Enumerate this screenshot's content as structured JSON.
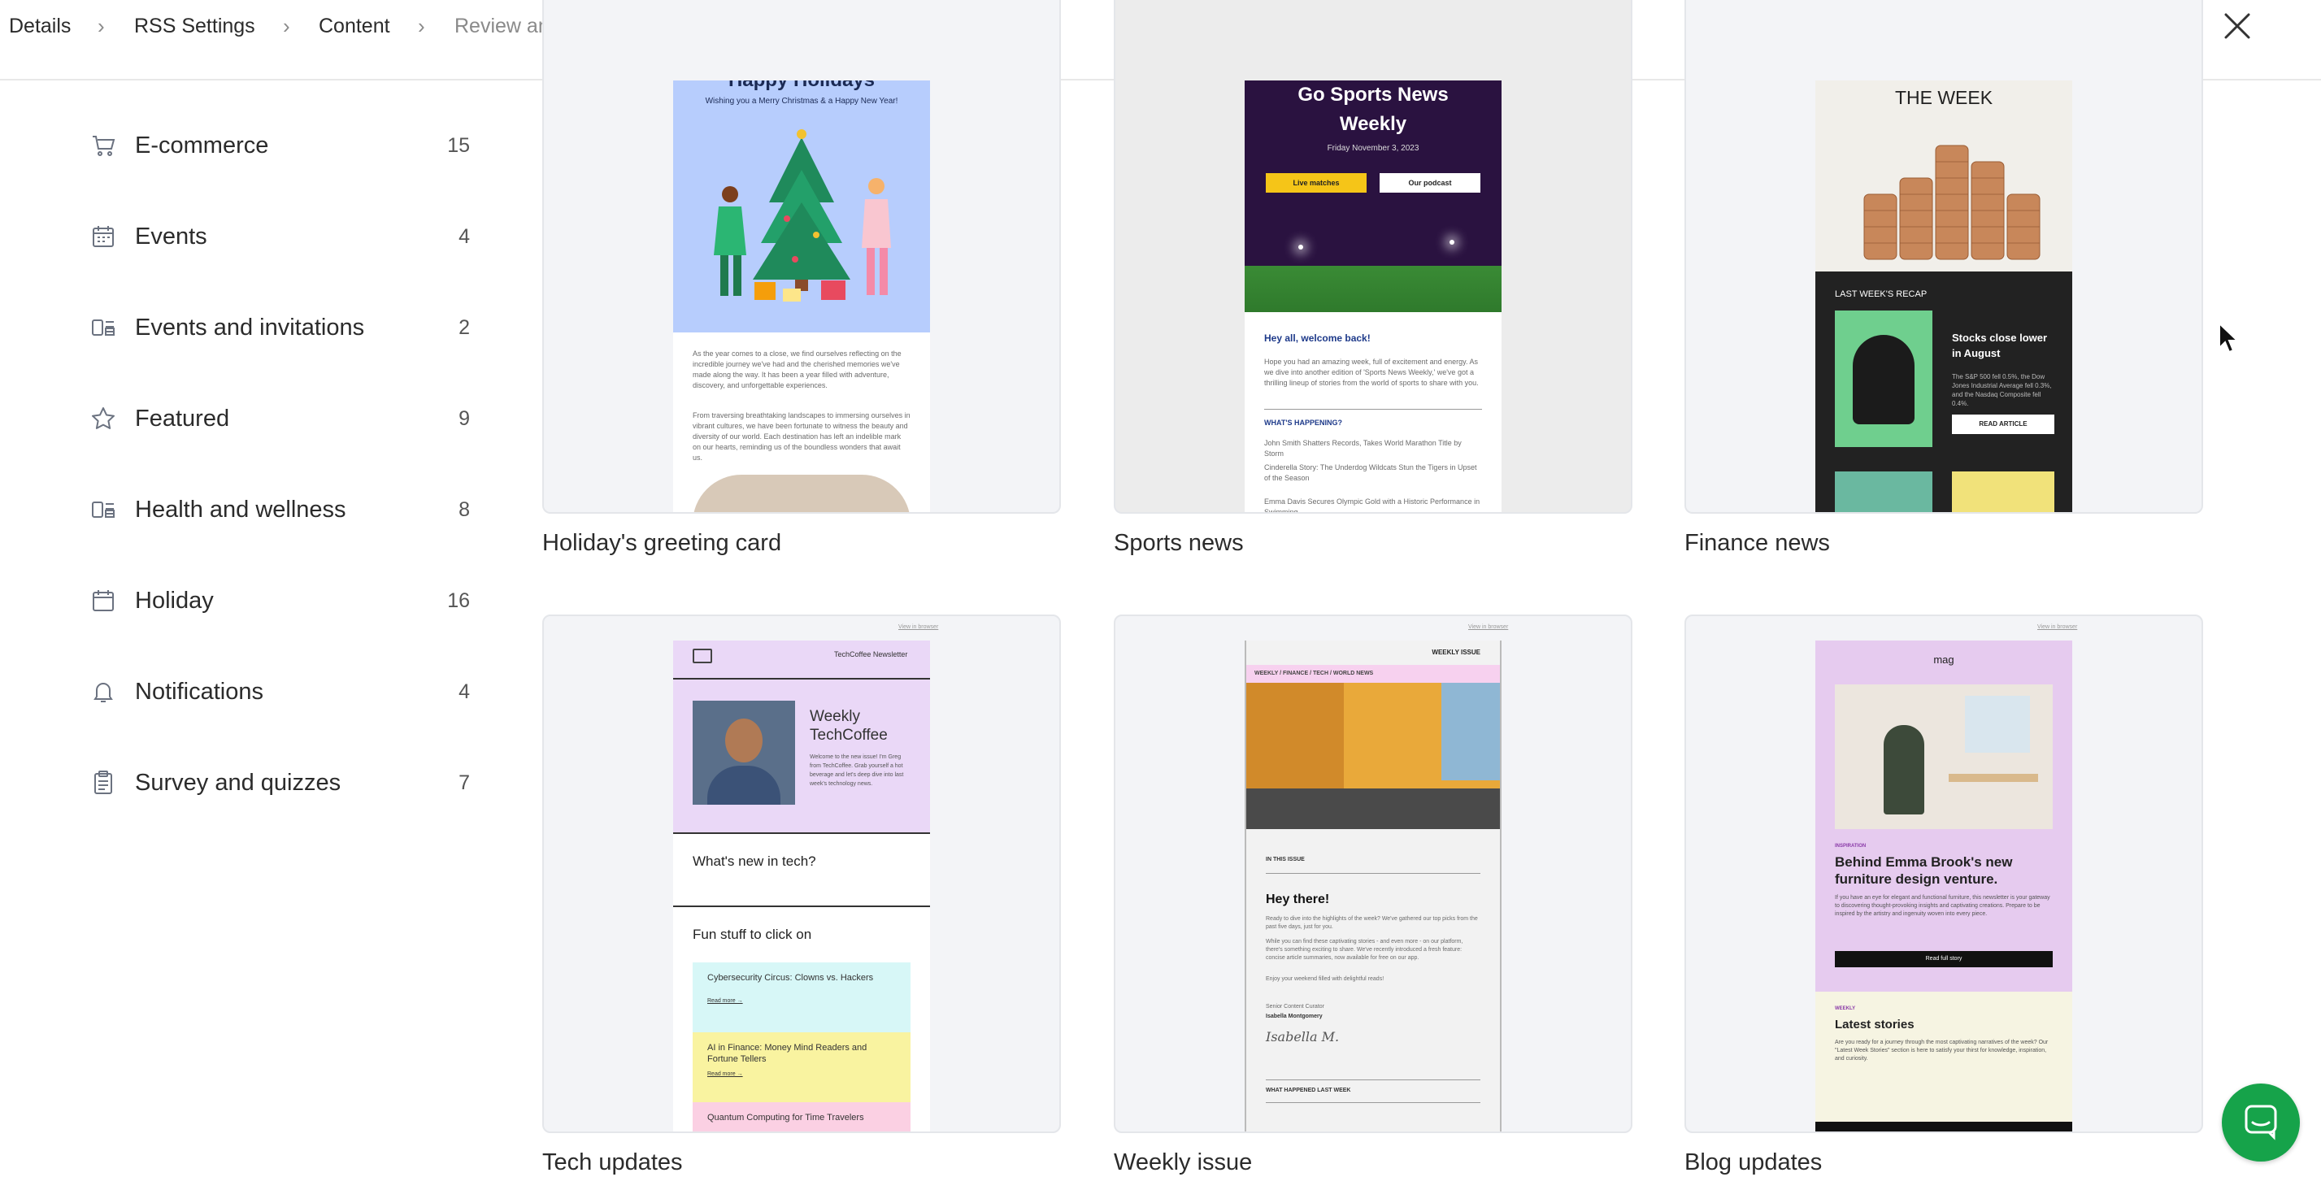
{
  "breadcrumb": {
    "items": [
      "Details",
      "RSS Settings",
      "Content",
      "Review and schedule"
    ]
  },
  "sidebar": {
    "items": [
      {
        "label": "E-commerce",
        "count": "15",
        "icon": "cart-icon"
      },
      {
        "label": "Events",
        "count": "4",
        "icon": "calendar-icon"
      },
      {
        "label": "Events and invitations",
        "count": "2",
        "icon": "layout-icon"
      },
      {
        "label": "Featured",
        "count": "9",
        "icon": "star-icon"
      },
      {
        "label": "Health and wellness",
        "count": "8",
        "icon": "layout-icon"
      },
      {
        "label": "Holiday",
        "count": "16",
        "icon": "calendar-icon"
      },
      {
        "label": "Notifications",
        "count": "4",
        "icon": "bell-icon"
      },
      {
        "label": "Survey and quizzes",
        "count": "7",
        "icon": "clipboard-icon"
      }
    ]
  },
  "templates": [
    {
      "name": "Holiday's greeting card",
      "thumb": {
        "title": "Happy Holidays",
        "subtitle": "Wishing you a Merry Christmas & a Happy New Year!",
        "p1": "As the year comes to a close, we find ourselves reflecting on the incredible journey we've had and the cherished memories we've made along the way. It has been a year filled with adventure, discovery, and unforgettable experiences.",
        "p2": "From traversing breathtaking landscapes to immersing ourselves in vibrant cultures, we have been fortunate to witness the beauty and diversity of our world. Each destination has left an indelible mark on our hearts, reminding us of the boundless wonders that await us."
      }
    },
    {
      "name": "Sports news",
      "thumb": {
        "title": "Go Sports News Weekly",
        "date": "Friday November 3, 2023",
        "btn1": "Live matches",
        "btn2": "Our podcast",
        "heading": "Hey all, welcome back!",
        "p1": "Hope you had an amazing week, full of excitement and energy. As we dive into another edition of 'Sports News Weekly,' we've got a thrilling lineup of stories from the world of sports to share with you.",
        "section": "WHAT'S HAPPENING?",
        "items": [
          "John Smith Shatters Records, Takes World Marathon Title by Storm",
          "Cinderella Story: The Underdog Wildcats Stun the Tigers in Upset of the Season",
          "Emma Davis Secures Olympic Gold with a Historic Performance in Swimming"
        ]
      }
    },
    {
      "name": "Finance news",
      "thumb": {
        "title": "FINANCE NEWS FOR THE WEEK",
        "recap": "LAST WEEK'S RECAP",
        "headline": "Stocks close lower in August",
        "p1": "The S&P 500 fell 0.5%, the Dow Jones Industrial Average fell 0.3%, and the Nasdaq Composite fell 0.4%.",
        "btn": "READ ARTICLE"
      }
    },
    {
      "name": "Tech updates",
      "thumb": {
        "brand": "TechCoffee Newsletter",
        "view": "View in browser",
        "title": "Weekly TechCoffee",
        "intro": "Welcome to the new issue! I'm Greg from TechCoffee. Grab yourself a hot beverage and let's deep dive into last week's technology news.",
        "section1": "What's new in tech?",
        "section2": "Fun stuff to click on",
        "items": [
          "Cybersecurity Circus: Clowns vs. Hackers",
          "AI in Finance: Money Mind Readers and Fortune Tellers",
          "Quantum Computing for Time Travelers"
        ],
        "readmore": "Read more →"
      }
    },
    {
      "name": "Weekly issue",
      "thumb": {
        "view": "View in browser",
        "badge": "WEEKLY ISSUE",
        "nav": "WEEKLY / FINANCE / TECH / WORLD NEWS",
        "section": "IN THIS ISSUE",
        "heading": "Hey there!",
        "p1": "Ready to dive into the highlights of the week? We've gathered our top picks from the past five days, just for you.",
        "p2": "While you can find these captivating stories - and even more - on our platform, there's something exciting to share. We've recently introduced a fresh feature: concise article summaries, now available for free on our app.",
        "p3": "Enjoy your weekend filled with delightful reads!",
        "role": "Senior Content Curator",
        "author": "Isabella Montgomery",
        "signature": "Isabella M.",
        "footer": "WHAT HAPPENED LAST WEEK"
      }
    },
    {
      "name": "Blog updates",
      "thumb": {
        "view": "View in browser",
        "brand": "mag",
        "tag": "INSPIRATION",
        "headline": "Behind Emma Brook's new furniture design venture.",
        "p1": "If you have an eye for elegant and functional furniture, this newsletter is your gateway to discovering thought-provoking insights and captivating creations. Prepare to be inspired by the artistry and ingenuity woven into every piece.",
        "btn": "Read full story",
        "tag2": "WEEKLY",
        "section": "Latest stories",
        "p2": "Are you ready for a journey through the most captivating narratives of the week? Our \"Latest Week Stories\" section is here to satisfy your thirst for knowledge, inspiration, and curiosity."
      }
    }
  ],
  "colors": {
    "accent": "#16a34a",
    "holiday_bg": "#b7cdfd",
    "sports_bg": "#2a1240",
    "finance_dark": "#222222",
    "tech_lilac": "#ead8f7",
    "blog_lilac": "#e6cbef"
  }
}
